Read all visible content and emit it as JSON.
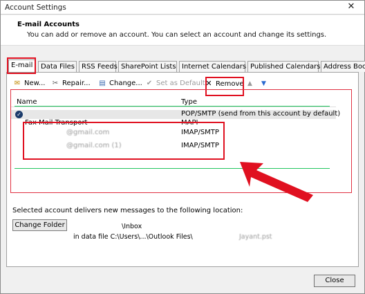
{
  "window": {
    "title": "Account Settings",
    "close_glyph": "✕"
  },
  "header": {
    "title": "E-mail Accounts",
    "description": "You can add or remove an account. You can select an account and change its settings."
  },
  "tabs": [
    {
      "label": "E-mail",
      "active": true
    },
    {
      "label": "Data Files"
    },
    {
      "label": "RSS Feeds"
    },
    {
      "label": "SharePoint Lists"
    },
    {
      "label": "Internet Calendars"
    },
    {
      "label": "Published Calendars"
    },
    {
      "label": "Address Books"
    }
  ],
  "toolbar": {
    "new_label": "New...",
    "repair_label": "Repair...",
    "change_label": "Change...",
    "set_default_label": "Set as Default",
    "remove_label": "Remove",
    "up_glyph": "▲",
    "down_glyph": "▼"
  },
  "list": {
    "columns": {
      "name": "Name",
      "type": "Type"
    },
    "rows": [
      {
        "name": "",
        "type": "POP/SMTP (send from this account by default)"
      },
      {
        "name": "Fax Mail Transport",
        "type": "MAPI"
      },
      {
        "name": "@gmail.com",
        "type": "IMAP/SMTP"
      },
      {
        "name": "@gmail.com (1)",
        "type": "IMAP/SMTP"
      }
    ]
  },
  "delivery": {
    "label": "Selected account delivers new messages to the following location:",
    "change_folder_label": "Change Folder",
    "inbox_label": "\\Inbox",
    "path": "in data file C:\\Users\\...\\Outlook Files\\",
    "pst_suffix": "Jayant.pst"
  },
  "footer": {
    "close_label": "Close"
  },
  "colors": {
    "annotation_red": "#e01020",
    "guide_green": "#22c55e",
    "default_check": "#1a3a6a"
  }
}
